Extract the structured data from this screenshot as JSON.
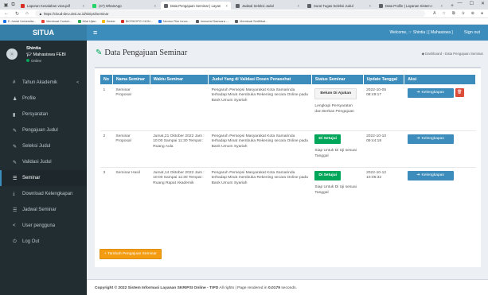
{
  "browser": {
    "tabs": [
      {
        "label": "Laporan Kesalahan view.pdf",
        "color": "#d93025",
        "active": false
      },
      {
        "label": "(47) WhatsApp",
        "color": "#25d366",
        "active": false
      },
      {
        "label": "Data Pengajuan Seminar | Layan",
        "color": "#5f6368",
        "active": true
      },
      {
        "label": "Jadwal Seleksi Judul",
        "color": "#5f6368",
        "active": false
      },
      {
        "label": "Surat Tugas Seleksi Judul",
        "color": "#5f6368",
        "active": false
      },
      {
        "label": "Data Profile | Layanan Sistem I",
        "color": "#5f6368",
        "active": false
      }
    ],
    "new_tab": "+",
    "window_controls": [
      "—",
      "☐",
      "✕"
    ],
    "url": "https://cloud-dev.uinsi.ac.id/skripsi/seminar",
    "bookmarks": [
      {
        "label": "E-Jurnal Universita...",
        "color": "#1a73e8"
      },
      {
        "label": "Membuat Contoh...",
        "color": "#ea4335"
      },
      {
        "label": "Nilai Ujian",
        "color": "#34a853"
      },
      {
        "label": "Dexter",
        "color": "#fbbc04"
      },
      {
        "label": "BIOSKOP21 NON...",
        "color": "#d93025"
      },
      {
        "label": "Nonton Film Innoc...",
        "color": "#1a73e8"
      },
      {
        "label": "Immortal Samsara -...",
        "color": "#5f6368"
      },
      {
        "label": "Membuat Sertifikat...",
        "color": "#5f6368"
      }
    ]
  },
  "app": {
    "brand": "SITUA",
    "welcome": "Welcome, ☞ Shintia | [ Mahasiswa ]",
    "signout": "Sign out"
  },
  "sidebar": {
    "user_name": "Shintia",
    "user_role": "Mahasiswa FEBI",
    "status": "Online",
    "items": [
      {
        "label": "Tahun Akademik",
        "icon": "#",
        "name": "sidebar-item-tahun-akademik",
        "caret": "<",
        "active": false
      },
      {
        "label": "Profile",
        "icon": "♟",
        "name": "sidebar-item-profile",
        "active": false
      },
      {
        "label": "Persyaratan",
        "icon": "▮",
        "name": "sidebar-item-persyaratan",
        "active": false
      },
      {
        "label": "Pengajuan Judul",
        "icon": "✎",
        "name": "sidebar-item-pengajuan-judul",
        "active": false
      },
      {
        "label": "Seleksi Judul",
        "icon": "✎",
        "name": "sidebar-item-seleksi-judul",
        "active": false
      },
      {
        "label": "Validasi Judul",
        "icon": "✎",
        "name": "sidebar-item-validasi-judul",
        "active": false
      },
      {
        "label": "Seminar",
        "icon": "☰",
        "name": "sidebar-item-seminar",
        "active": true
      },
      {
        "label": "Download Kelengkapan",
        "icon": "⤓",
        "name": "sidebar-item-download",
        "active": false
      },
      {
        "label": "Jadwal Seminar",
        "icon": "☰",
        "name": "sidebar-item-jadwal-seminar",
        "active": false
      },
      {
        "label": "User pengguna",
        "icon": "<",
        "name": "sidebar-item-user-pengguna",
        "active": false
      },
      {
        "label": "Log Out",
        "icon": "⏻",
        "name": "sidebar-item-logout",
        "active": false
      }
    ]
  },
  "page": {
    "title": "Data Pengajuan Seminar",
    "breadcrumb_home": "Dashboard",
    "breadcrumb_current": "Data Pengajuan Seminar"
  },
  "table": {
    "headers": [
      "No",
      "Nama Seminar",
      "Waktu Seminar",
      "Judul Yang di Validasi Dosen Penasehat",
      "Status Seminar",
      "Update Tanggal",
      "Aksi"
    ],
    "rows": [
      {
        "no": "1",
        "nama": "Seminar Proposal",
        "waktu": "",
        "judul": "Pengaruh Persepsi Masyarakat Kota Samarinda terhadap Minat membuka Rekening secara Online pada Bank Umum Syariah",
        "status_badge": "Belum Di Ajukan",
        "status_style": "white",
        "status_note": "Lengkapi Persyaratan dan Berkas Pengajuan",
        "tanggal": "2022-10-05 08:49:17",
        "aksi": "Kelengkapan",
        "delete": true
      },
      {
        "no": "2",
        "nama": "Seminar Proposal",
        "waktu": "Jumat,21 Oktober 2022 Jam : 10:00 Sampai 11:30 Tempat : Ruang Aula",
        "judul": "Pengaruh Persepsi Masyarakat Kota Samarinda terhadap Minat membuka Rekening secara Online pada Bank Umum Syariah",
        "status_badge": "Di Setujui",
        "status_style": "green",
        "status_note": "Siap Untuk Di Uji sesuai Tanggal",
        "tanggal": "2022-10-10 09:44:18",
        "aksi": "Kelengkapan",
        "delete": false
      },
      {
        "no": "3",
        "nama": "Seminar Hasil",
        "waktu": "Jumat,14 Oktober 2022 Jam : 10:00 Sampai 11:30 Tempat : Ruang Rapat Akademik",
        "judul": "Pengaruh Persepsi Masyarakat Kota Samarinda terhadap Minat membuka Rekening secara Online pada Bank Umum Syariah",
        "status_badge": "Di Setujui",
        "status_style": "green",
        "status_note": "Siap Untuk Di Uji sesuai Tanggal",
        "tanggal": "2022-10-12 10:06:32",
        "aksi": "Kelengkapan",
        "delete": false
      }
    ],
    "add_button": "Tambah Pengajuan Seminar"
  },
  "footer": {
    "prefix": "Copyright © 2022 Sistem Informasi Layanan SKRIPSI Online - TIPD",
    "middle": " All rights | Page rendered in ",
    "time": "0.0179",
    "suffix": " seconds."
  },
  "colors": {
    "header_blue": "#3c8dbc",
    "brand_blue": "#367fa9",
    "sidebar_dark": "#222d32",
    "success_green": "#00a65a",
    "danger_red": "#dd4b39",
    "warning_orange": "#f39c12"
  }
}
